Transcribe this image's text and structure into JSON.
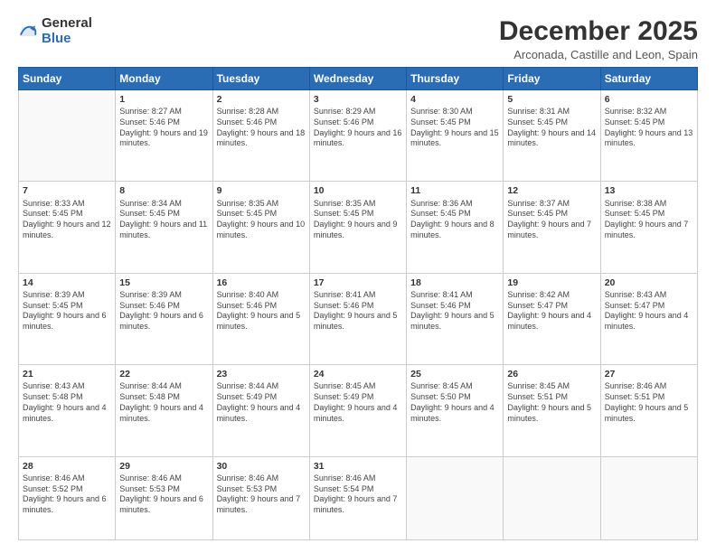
{
  "logo": {
    "general": "General",
    "blue": "Blue"
  },
  "header": {
    "title": "December 2025",
    "subtitle": "Arconada, Castille and Leon, Spain"
  },
  "days_of_week": [
    "Sunday",
    "Monday",
    "Tuesday",
    "Wednesday",
    "Thursday",
    "Friday",
    "Saturday"
  ],
  "weeks": [
    [
      {
        "day": "",
        "sunrise": "",
        "sunset": "",
        "daylight": ""
      },
      {
        "day": "1",
        "sunrise": "Sunrise: 8:27 AM",
        "sunset": "Sunset: 5:46 PM",
        "daylight": "Daylight: 9 hours and 19 minutes."
      },
      {
        "day": "2",
        "sunrise": "Sunrise: 8:28 AM",
        "sunset": "Sunset: 5:46 PM",
        "daylight": "Daylight: 9 hours and 18 minutes."
      },
      {
        "day": "3",
        "sunrise": "Sunrise: 8:29 AM",
        "sunset": "Sunset: 5:46 PM",
        "daylight": "Daylight: 9 hours and 16 minutes."
      },
      {
        "day": "4",
        "sunrise": "Sunrise: 8:30 AM",
        "sunset": "Sunset: 5:45 PM",
        "daylight": "Daylight: 9 hours and 15 minutes."
      },
      {
        "day": "5",
        "sunrise": "Sunrise: 8:31 AM",
        "sunset": "Sunset: 5:45 PM",
        "daylight": "Daylight: 9 hours and 14 minutes."
      },
      {
        "day": "6",
        "sunrise": "Sunrise: 8:32 AM",
        "sunset": "Sunset: 5:45 PM",
        "daylight": "Daylight: 9 hours and 13 minutes."
      }
    ],
    [
      {
        "day": "7",
        "sunrise": "Sunrise: 8:33 AM",
        "sunset": "Sunset: 5:45 PM",
        "daylight": "Daylight: 9 hours and 12 minutes."
      },
      {
        "day": "8",
        "sunrise": "Sunrise: 8:34 AM",
        "sunset": "Sunset: 5:45 PM",
        "daylight": "Daylight: 9 hours and 11 minutes."
      },
      {
        "day": "9",
        "sunrise": "Sunrise: 8:35 AM",
        "sunset": "Sunset: 5:45 PM",
        "daylight": "Daylight: 9 hours and 10 minutes."
      },
      {
        "day": "10",
        "sunrise": "Sunrise: 8:35 AM",
        "sunset": "Sunset: 5:45 PM",
        "daylight": "Daylight: 9 hours and 9 minutes."
      },
      {
        "day": "11",
        "sunrise": "Sunrise: 8:36 AM",
        "sunset": "Sunset: 5:45 PM",
        "daylight": "Daylight: 9 hours and 8 minutes."
      },
      {
        "day": "12",
        "sunrise": "Sunrise: 8:37 AM",
        "sunset": "Sunset: 5:45 PM",
        "daylight": "Daylight: 9 hours and 7 minutes."
      },
      {
        "day": "13",
        "sunrise": "Sunrise: 8:38 AM",
        "sunset": "Sunset: 5:45 PM",
        "daylight": "Daylight: 9 hours and 7 minutes."
      }
    ],
    [
      {
        "day": "14",
        "sunrise": "Sunrise: 8:39 AM",
        "sunset": "Sunset: 5:45 PM",
        "daylight": "Daylight: 9 hours and 6 minutes."
      },
      {
        "day": "15",
        "sunrise": "Sunrise: 8:39 AM",
        "sunset": "Sunset: 5:46 PM",
        "daylight": "Daylight: 9 hours and 6 minutes."
      },
      {
        "day": "16",
        "sunrise": "Sunrise: 8:40 AM",
        "sunset": "Sunset: 5:46 PM",
        "daylight": "Daylight: 9 hours and 5 minutes."
      },
      {
        "day": "17",
        "sunrise": "Sunrise: 8:41 AM",
        "sunset": "Sunset: 5:46 PM",
        "daylight": "Daylight: 9 hours and 5 minutes."
      },
      {
        "day": "18",
        "sunrise": "Sunrise: 8:41 AM",
        "sunset": "Sunset: 5:46 PM",
        "daylight": "Daylight: 9 hours and 5 minutes."
      },
      {
        "day": "19",
        "sunrise": "Sunrise: 8:42 AM",
        "sunset": "Sunset: 5:47 PM",
        "daylight": "Daylight: 9 hours and 4 minutes."
      },
      {
        "day": "20",
        "sunrise": "Sunrise: 8:43 AM",
        "sunset": "Sunset: 5:47 PM",
        "daylight": "Daylight: 9 hours and 4 minutes."
      }
    ],
    [
      {
        "day": "21",
        "sunrise": "Sunrise: 8:43 AM",
        "sunset": "Sunset: 5:48 PM",
        "daylight": "Daylight: 9 hours and 4 minutes."
      },
      {
        "day": "22",
        "sunrise": "Sunrise: 8:44 AM",
        "sunset": "Sunset: 5:48 PM",
        "daylight": "Daylight: 9 hours and 4 minutes."
      },
      {
        "day": "23",
        "sunrise": "Sunrise: 8:44 AM",
        "sunset": "Sunset: 5:49 PM",
        "daylight": "Daylight: 9 hours and 4 minutes."
      },
      {
        "day": "24",
        "sunrise": "Sunrise: 8:45 AM",
        "sunset": "Sunset: 5:49 PM",
        "daylight": "Daylight: 9 hours and 4 minutes."
      },
      {
        "day": "25",
        "sunrise": "Sunrise: 8:45 AM",
        "sunset": "Sunset: 5:50 PM",
        "daylight": "Daylight: 9 hours and 4 minutes."
      },
      {
        "day": "26",
        "sunrise": "Sunrise: 8:45 AM",
        "sunset": "Sunset: 5:51 PM",
        "daylight": "Daylight: 9 hours and 5 minutes."
      },
      {
        "day": "27",
        "sunrise": "Sunrise: 8:46 AM",
        "sunset": "Sunset: 5:51 PM",
        "daylight": "Daylight: 9 hours and 5 minutes."
      }
    ],
    [
      {
        "day": "28",
        "sunrise": "Sunrise: 8:46 AM",
        "sunset": "Sunset: 5:52 PM",
        "daylight": "Daylight: 9 hours and 6 minutes."
      },
      {
        "day": "29",
        "sunrise": "Sunrise: 8:46 AM",
        "sunset": "Sunset: 5:53 PM",
        "daylight": "Daylight: 9 hours and 6 minutes."
      },
      {
        "day": "30",
        "sunrise": "Sunrise: 8:46 AM",
        "sunset": "Sunset: 5:53 PM",
        "daylight": "Daylight: 9 hours and 7 minutes."
      },
      {
        "day": "31",
        "sunrise": "Sunrise: 8:46 AM",
        "sunset": "Sunset: 5:54 PM",
        "daylight": "Daylight: 9 hours and 7 minutes."
      },
      {
        "day": "",
        "sunrise": "",
        "sunset": "",
        "daylight": ""
      },
      {
        "day": "",
        "sunrise": "",
        "sunset": "",
        "daylight": ""
      },
      {
        "day": "",
        "sunrise": "",
        "sunset": "",
        "daylight": ""
      }
    ]
  ]
}
